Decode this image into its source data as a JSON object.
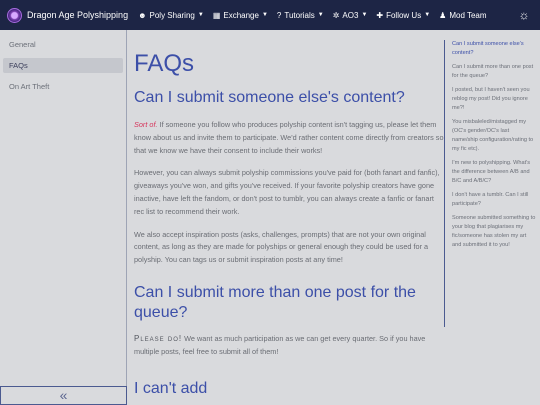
{
  "navbar": {
    "title": "Dragon Age Polyshipping",
    "items": [
      {
        "label": "Poly Sharing",
        "icon": "users-icon",
        "caret": true
      },
      {
        "label": "Exchange",
        "icon": "exchange-icon",
        "caret": true
      },
      {
        "label": "Tutorials",
        "icon": "question-icon",
        "caret": true
      },
      {
        "label": "AO3",
        "icon": "ao3-icon",
        "caret": true
      },
      {
        "label": "Follow Us",
        "icon": "user-plus-icon",
        "caret": true
      },
      {
        "label": "Mod Team",
        "icon": "team-icon",
        "caret": false
      }
    ],
    "theme_icon": "sun-icon"
  },
  "sidebar": {
    "items": [
      {
        "label": "General",
        "active": false
      },
      {
        "label": "FAQs",
        "active": true
      },
      {
        "label": "On Art Theft",
        "active": false
      }
    ],
    "collapse_glyph": "«"
  },
  "main": {
    "title": "FAQs",
    "q1": {
      "heading": "Can I submit someone else's content?",
      "p1_accent": "Sort of.",
      "p1_rest": " If someone you follow who produces polyship content isn't tagging us, please let them know about us and invite them to participate. We'd rather content come directly from creators so that we know we have their consent to include their works!",
      "p2": "However, you can always submit polyship commissions you've paid for (both fanart and fanfic), giveaways you've won, and gifts you've received. If your favorite polyship creators have gone inactive, have left the fandom, or don't post to tumblr, you can always create a fanfic or fanart rec list to recommend their work.",
      "p3": "We also accept inspiration posts (asks, challenges, prompts) that are not your own original content, as long as they are made for polyships or general enough they could be used for a polyship. You can tags us or submit inspiration posts at any time!"
    },
    "q2": {
      "heading": "Can I submit more than one post for the queue?",
      "p1_caps": "Please do!",
      "p1_rest": " We want as much participation as we can get every quarter. So if you have multiple posts, feel free to submit all of them!"
    },
    "q3_heading_partial": "I can't add "
  },
  "toc": {
    "items": [
      {
        "label": "Can I submit someone else's content?",
        "active": true
      },
      {
        "label": "Can I submit more than one post for the queue?",
        "active": false
      },
      {
        "label": "I posted, but I haven't seen you reblog my post! Did you ignore me?!",
        "active": false
      },
      {
        "label": "You misbaleled/mistagged my (OC's gender/OC's last name/ship configuration/rating to my fic etc).",
        "active": false
      },
      {
        "label": "I'm new to polyshipping. What's the difference between A/B and B/C and A/B/C?",
        "active": false
      },
      {
        "label": "I don't have a tumblr. Can I still participate?",
        "active": false
      },
      {
        "label": "Someone submitted something to your blog that plagiarises my fic/someone has stolen my art and submitted it to you!",
        "active": false
      }
    ]
  }
}
